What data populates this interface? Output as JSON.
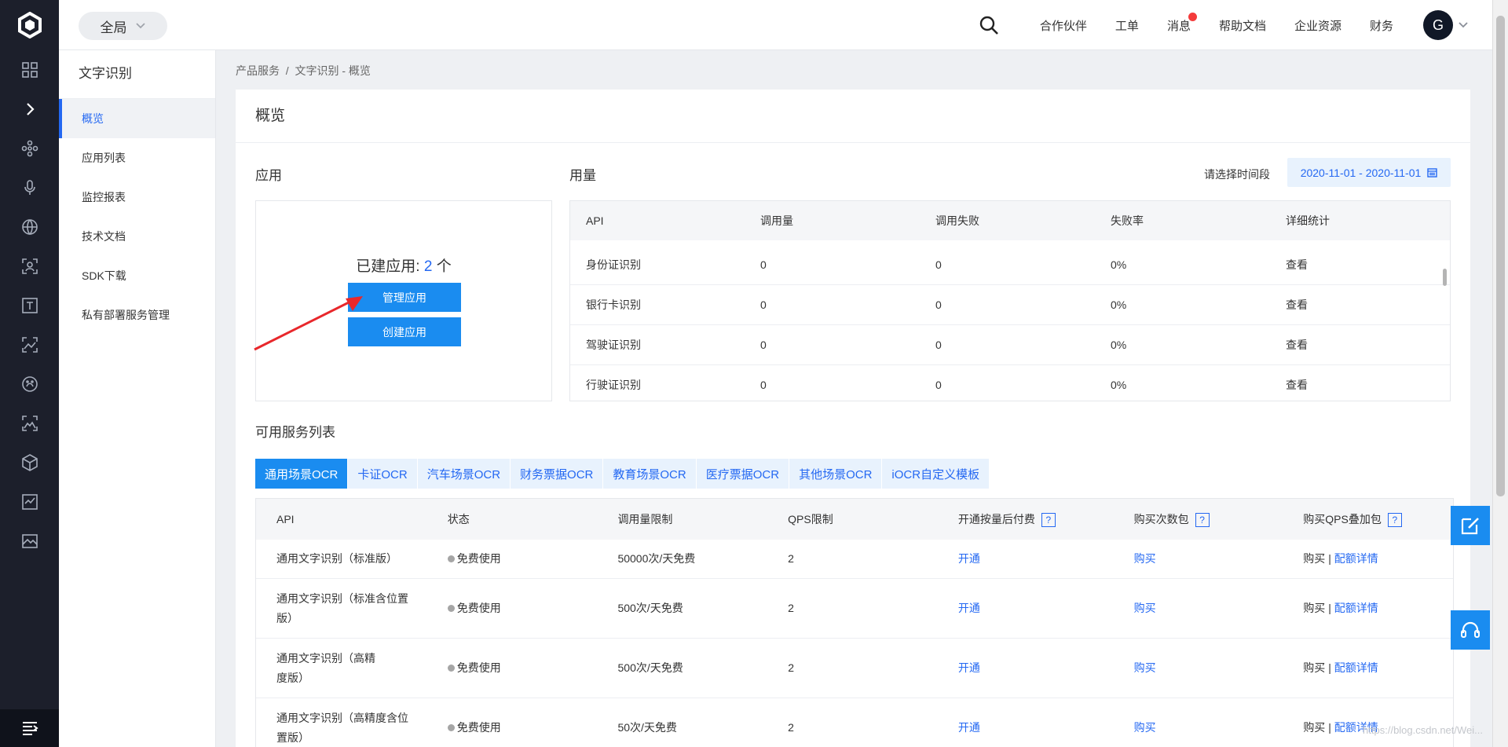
{
  "header": {
    "scope_label": "全局",
    "nav": [
      {
        "label": "合作伙伴",
        "dot": false
      },
      {
        "label": "工单",
        "dot": false
      },
      {
        "label": "消息",
        "dot": true
      },
      {
        "label": "帮助文档",
        "dot": false
      },
      {
        "label": "企业资源",
        "dot": false
      },
      {
        "label": "财务",
        "dot": false
      }
    ],
    "avatar_letter": "G"
  },
  "rail_icons": [
    "logo-icon",
    "grid-icon",
    "chevron-right-icon",
    "network-icon",
    "microphone-icon",
    "globe-icon",
    "scan-icon",
    "text-icon",
    "image-icon",
    "face-icon",
    "photo-icon",
    "cube-icon",
    "report-icon",
    "landscape-icon",
    "menu-icon"
  ],
  "sidebar": {
    "title": "文字识别",
    "items": [
      "概览",
      "应用列表",
      "监控报表",
      "技术文档",
      "SDK下载",
      "私有部署服务管理"
    ],
    "active_index": 0
  },
  "breadcrumb": {
    "parent": "产品服务",
    "separator": "/",
    "current": "文字识别 - 概览"
  },
  "overview": {
    "title": "概览",
    "apps": {
      "section_title": "应用",
      "count_prefix": "已建应用: ",
      "count": "2",
      "count_suffix": " 个",
      "manage_button": "管理应用",
      "create_button": "创建应用"
    },
    "usage": {
      "section_title": "用量",
      "date_label": "请选择时间段",
      "date_range": "2020-11-01 - 2020-11-01",
      "columns": [
        "API",
        "调用量",
        "调用失败",
        "失败率",
        "详细统计"
      ],
      "rows": [
        {
          "api": "身份证识别",
          "calls": "0",
          "failed": "0",
          "rate": "0%",
          "detail": "查看"
        },
        {
          "api": "银行卡识别",
          "calls": "0",
          "failed": "0",
          "rate": "0%",
          "detail": "查看"
        },
        {
          "api": "驾驶证识别",
          "calls": "0",
          "failed": "0",
          "rate": "0%",
          "detail": "查看"
        },
        {
          "api": "行驶证识别",
          "calls": "0",
          "failed": "0",
          "rate": "0%",
          "detail": "查看"
        }
      ]
    },
    "services": {
      "section_title": "可用服务列表",
      "tabs": [
        "通用场景OCR",
        "卡证OCR",
        "汽车场景OCR",
        "财务票据OCR",
        "教育场景OCR",
        "医疗票据OCR",
        "其他场景OCR",
        "iOCR自定义模板"
      ],
      "active_tab": 0,
      "columns": [
        "API",
        "状态",
        "调用量限制",
        "QPS限制",
        "开通按量后付费",
        "购买次数包",
        "购买QPS叠加包"
      ],
      "help_mark": "?",
      "rows": [
        {
          "api": "通用文字识别（标准版）",
          "status": "免费使用",
          "limit": "50000次/天免费",
          "qps": "2",
          "open": "开通",
          "buy": "购买",
          "qps_buy": "购买",
          "sep": "|",
          "quota": "配额详情"
        },
        {
          "api": "通用文字识别（标准含位置版）",
          "status": "免费使用",
          "limit": "500次/天免费",
          "qps": "2",
          "open": "开通",
          "buy": "购买",
          "qps_buy": "购买",
          "sep": "|",
          "quota": "配额详情"
        },
        {
          "api": "通用文字识别（高精度版）",
          "status": "免费使用",
          "limit": "500次/天免费",
          "qps": "2",
          "open": "开通",
          "buy": "购买",
          "qps_buy": "购买",
          "sep": "|",
          "quota": "配额详情"
        },
        {
          "api": "通用文字识别（高精度含位置版）",
          "status": "免费使用",
          "limit": "50次/天免费",
          "qps": "2",
          "open": "开通",
          "buy": "购买",
          "qps_buy": "购买",
          "sep": "|",
          "quota": "配额详情"
        }
      ]
    }
  },
  "watermark": "https://blog.csdn.net/Wei...",
  "colors": {
    "accent": "#1a8cf0",
    "link": "#2468f2",
    "rail_bg": "#1c1f2b",
    "annotation_arrow": "#e8272b"
  }
}
